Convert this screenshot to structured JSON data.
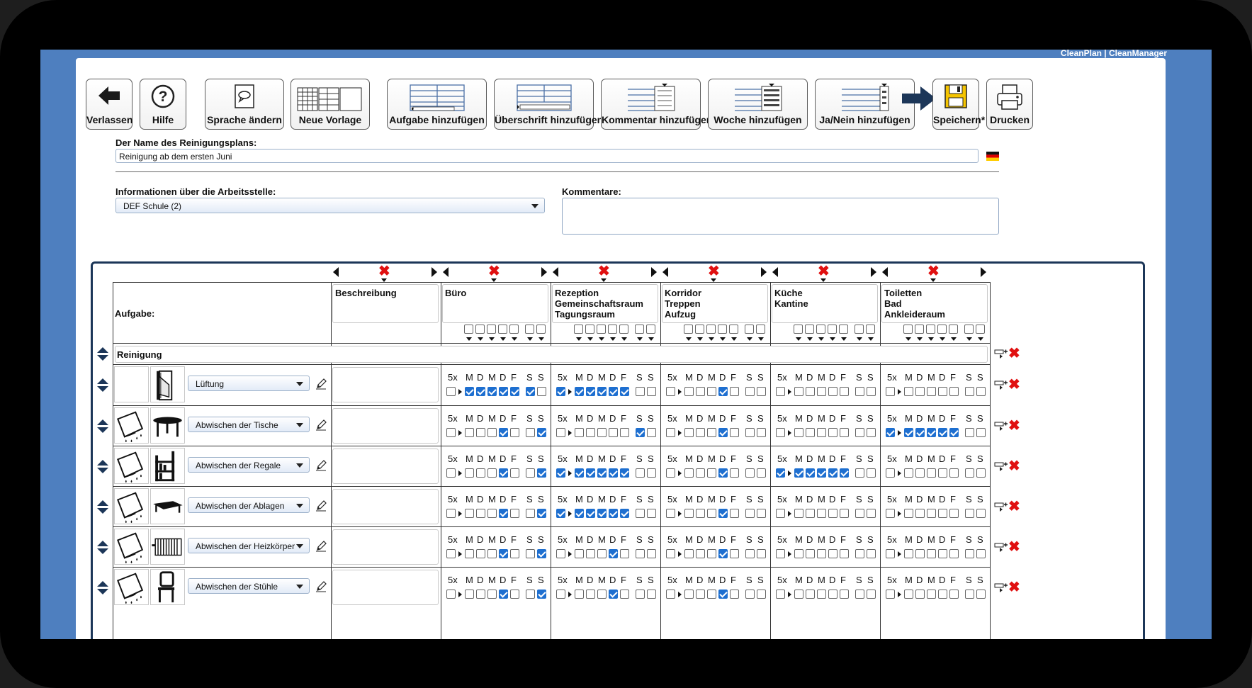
{
  "brand": "CleanPlan | CleanManager",
  "toolbar": [
    {
      "id": "verlassen",
      "label": "Verlassen",
      "icon": "back-arrow-icon"
    },
    {
      "id": "hilfe",
      "label": "Hilfe",
      "icon": "help-icon"
    },
    {
      "id": "sprache",
      "label": "Sprache ändern",
      "icon": "speech-bubble-icon"
    },
    {
      "id": "vorlage",
      "label": "Neue Vorlage",
      "icon": "template-icon"
    },
    {
      "id": "aufgabe",
      "label": "Aufgabe hinzufügen",
      "icon": "add-task-icon"
    },
    {
      "id": "ueberschrift",
      "label": "Überschrift hinzufügen",
      "icon": "add-heading-icon"
    },
    {
      "id": "kommentar",
      "label": "Kommentar hinzufügen",
      "icon": "add-comment-icon"
    },
    {
      "id": "woche",
      "label": "Woche hinzufügen",
      "icon": "add-week-icon"
    },
    {
      "id": "janein",
      "label": "Ja/Nein hinzufügen",
      "icon": "add-yes-no-icon"
    },
    {
      "id": "speichern",
      "label": "Speichern*",
      "icon": "floppy-disk-icon"
    },
    {
      "id": "drucken",
      "label": "Drucken",
      "icon": "printer-icon"
    }
  ],
  "plan_name": {
    "label": "Der Name des Reinigungsplans:",
    "value": "Reinigung ab dem ersten Juni"
  },
  "workplace": {
    "label": "Informationen über die Arbeitsstelle:",
    "value": "DEF Schule (2)"
  },
  "comments": {
    "label": "Kommentare:",
    "value": ""
  },
  "table": {
    "task_header": "Aufgabe:",
    "description_header": "Beschreibung",
    "section": "Reinigung",
    "freq_label": "5x",
    "days": [
      "M",
      "D",
      "M",
      "D",
      "F",
      "S",
      "S"
    ],
    "areas": [
      {
        "lines": [
          "Büro"
        ]
      },
      {
        "lines": [
          "Rezeption",
          "Gemeinschaftsraum",
          "Tagungsraum"
        ]
      },
      {
        "lines": [
          "Korridor",
          "Treppen",
          "Aufzug"
        ]
      },
      {
        "lines": [
          "Küche",
          "Kantine"
        ]
      },
      {
        "lines": [
          "Toiletten",
          "Bad",
          "Ankleideraum"
        ]
      }
    ],
    "tasks": [
      {
        "name": "Lüftung",
        "icon1": "",
        "icon2": "window-icon",
        "checks": [
          [
            0,
            1,
            1,
            1,
            1,
            1,
            1,
            0
          ],
          [
            1,
            1,
            1,
            1,
            1,
            1,
            0,
            0
          ],
          [
            0,
            0,
            0,
            0,
            1,
            0,
            0,
            0
          ],
          [
            0,
            0,
            0,
            0,
            0,
            0,
            0,
            0
          ],
          [
            0,
            0,
            0,
            0,
            0,
            0,
            0,
            0
          ]
        ]
      },
      {
        "name": "Abwischen der Tische",
        "icon1": "wipe-cloth-icon",
        "icon2": "table-icon",
        "checks": [
          [
            0,
            0,
            0,
            0,
            1,
            0,
            0,
            1
          ],
          [
            0,
            0,
            0,
            0,
            0,
            0,
            1,
            0
          ],
          [
            0,
            0,
            0,
            0,
            1,
            0,
            0,
            0
          ],
          [
            0,
            0,
            0,
            0,
            0,
            0,
            0,
            0
          ],
          [
            1,
            1,
            1,
            1,
            1,
            1,
            0,
            0
          ]
        ]
      },
      {
        "name": "Abwischen der Regale",
        "icon1": "wipe-cloth-icon",
        "icon2": "shelf-icon",
        "checks": [
          [
            0,
            0,
            0,
            0,
            1,
            0,
            0,
            1
          ],
          [
            1,
            1,
            1,
            1,
            1,
            1,
            0,
            0
          ],
          [
            0,
            0,
            0,
            0,
            1,
            0,
            0,
            0
          ],
          [
            1,
            1,
            1,
            1,
            1,
            1,
            0,
            0
          ],
          [
            0,
            0,
            0,
            0,
            0,
            0,
            0,
            0
          ]
        ]
      },
      {
        "name": "Abwischen der Ablagen",
        "icon1": "wipe-cloth-icon",
        "icon2": "bench-icon",
        "checks": [
          [
            0,
            0,
            0,
            0,
            1,
            0,
            0,
            1
          ],
          [
            1,
            1,
            1,
            1,
            1,
            1,
            0,
            0
          ],
          [
            0,
            0,
            0,
            0,
            1,
            0,
            0,
            0
          ],
          [
            0,
            0,
            0,
            0,
            0,
            0,
            0,
            0
          ],
          [
            0,
            0,
            0,
            0,
            0,
            0,
            0,
            0
          ]
        ]
      },
      {
        "name": "Abwischen der Heizkörper",
        "icon1": "wipe-cloth-icon",
        "icon2": "radiator-icon",
        "checks": [
          [
            0,
            0,
            0,
            0,
            1,
            0,
            0,
            1
          ],
          [
            0,
            0,
            0,
            0,
            1,
            0,
            0,
            0
          ],
          [
            0,
            0,
            0,
            0,
            1,
            0,
            0,
            0
          ],
          [
            0,
            0,
            0,
            0,
            0,
            0,
            0,
            0
          ],
          [
            0,
            0,
            0,
            0,
            0,
            0,
            0,
            0
          ]
        ]
      },
      {
        "name": "Abwischen der Stühle",
        "icon1": "wipe-cloth-icon",
        "icon2": "chair-icon",
        "checks": [
          [
            0,
            0,
            0,
            0,
            1,
            0,
            0,
            1
          ],
          [
            0,
            0,
            0,
            0,
            1,
            0,
            0,
            0
          ],
          [
            0,
            0,
            0,
            0,
            1,
            0,
            0,
            0
          ],
          [
            0,
            0,
            0,
            0,
            0,
            0,
            0,
            0
          ],
          [
            0,
            0,
            0,
            0,
            0,
            0,
            0,
            0
          ]
        ]
      }
    ]
  },
  "colors": {
    "screen_bg": "#4e7fbf",
    "table_border": "#1c3658",
    "check_on": "#1e6fd0",
    "delete_x": "#e01010",
    "save_icon": "#f5c400"
  }
}
